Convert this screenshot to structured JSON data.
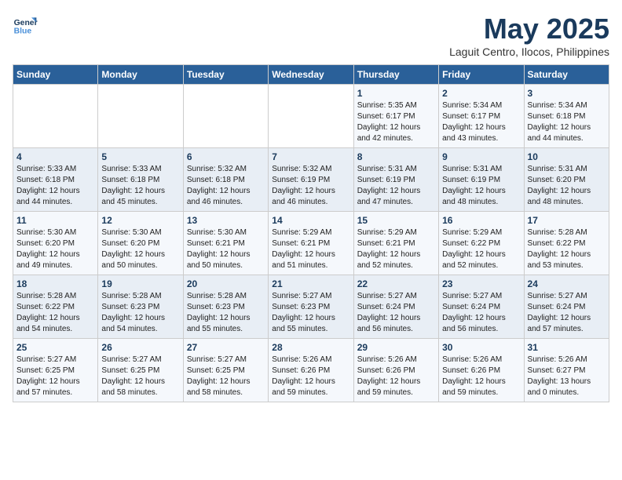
{
  "header": {
    "logo_line1": "General",
    "logo_line2": "Blue",
    "month": "May 2025",
    "location": "Laguit Centro, Ilocos, Philippines"
  },
  "weekdays": [
    "Sunday",
    "Monday",
    "Tuesday",
    "Wednesday",
    "Thursday",
    "Friday",
    "Saturday"
  ],
  "weeks": [
    [
      {
        "day": "",
        "info": ""
      },
      {
        "day": "",
        "info": ""
      },
      {
        "day": "",
        "info": ""
      },
      {
        "day": "",
        "info": ""
      },
      {
        "day": "1",
        "info": "Sunrise: 5:35 AM\nSunset: 6:17 PM\nDaylight: 12 hours\nand 42 minutes."
      },
      {
        "day": "2",
        "info": "Sunrise: 5:34 AM\nSunset: 6:17 PM\nDaylight: 12 hours\nand 43 minutes."
      },
      {
        "day": "3",
        "info": "Sunrise: 5:34 AM\nSunset: 6:18 PM\nDaylight: 12 hours\nand 44 minutes."
      }
    ],
    [
      {
        "day": "4",
        "info": "Sunrise: 5:33 AM\nSunset: 6:18 PM\nDaylight: 12 hours\nand 44 minutes."
      },
      {
        "day": "5",
        "info": "Sunrise: 5:33 AM\nSunset: 6:18 PM\nDaylight: 12 hours\nand 45 minutes."
      },
      {
        "day": "6",
        "info": "Sunrise: 5:32 AM\nSunset: 6:18 PM\nDaylight: 12 hours\nand 46 minutes."
      },
      {
        "day": "7",
        "info": "Sunrise: 5:32 AM\nSunset: 6:19 PM\nDaylight: 12 hours\nand 46 minutes."
      },
      {
        "day": "8",
        "info": "Sunrise: 5:31 AM\nSunset: 6:19 PM\nDaylight: 12 hours\nand 47 minutes."
      },
      {
        "day": "9",
        "info": "Sunrise: 5:31 AM\nSunset: 6:19 PM\nDaylight: 12 hours\nand 48 minutes."
      },
      {
        "day": "10",
        "info": "Sunrise: 5:31 AM\nSunset: 6:20 PM\nDaylight: 12 hours\nand 48 minutes."
      }
    ],
    [
      {
        "day": "11",
        "info": "Sunrise: 5:30 AM\nSunset: 6:20 PM\nDaylight: 12 hours\nand 49 minutes."
      },
      {
        "day": "12",
        "info": "Sunrise: 5:30 AM\nSunset: 6:20 PM\nDaylight: 12 hours\nand 50 minutes."
      },
      {
        "day": "13",
        "info": "Sunrise: 5:30 AM\nSunset: 6:21 PM\nDaylight: 12 hours\nand 50 minutes."
      },
      {
        "day": "14",
        "info": "Sunrise: 5:29 AM\nSunset: 6:21 PM\nDaylight: 12 hours\nand 51 minutes."
      },
      {
        "day": "15",
        "info": "Sunrise: 5:29 AM\nSunset: 6:21 PM\nDaylight: 12 hours\nand 52 minutes."
      },
      {
        "day": "16",
        "info": "Sunrise: 5:29 AM\nSunset: 6:22 PM\nDaylight: 12 hours\nand 52 minutes."
      },
      {
        "day": "17",
        "info": "Sunrise: 5:28 AM\nSunset: 6:22 PM\nDaylight: 12 hours\nand 53 minutes."
      }
    ],
    [
      {
        "day": "18",
        "info": "Sunrise: 5:28 AM\nSunset: 6:22 PM\nDaylight: 12 hours\nand 54 minutes."
      },
      {
        "day": "19",
        "info": "Sunrise: 5:28 AM\nSunset: 6:23 PM\nDaylight: 12 hours\nand 54 minutes."
      },
      {
        "day": "20",
        "info": "Sunrise: 5:28 AM\nSunset: 6:23 PM\nDaylight: 12 hours\nand 55 minutes."
      },
      {
        "day": "21",
        "info": "Sunrise: 5:27 AM\nSunset: 6:23 PM\nDaylight: 12 hours\nand 55 minutes."
      },
      {
        "day": "22",
        "info": "Sunrise: 5:27 AM\nSunset: 6:24 PM\nDaylight: 12 hours\nand 56 minutes."
      },
      {
        "day": "23",
        "info": "Sunrise: 5:27 AM\nSunset: 6:24 PM\nDaylight: 12 hours\nand 56 minutes."
      },
      {
        "day": "24",
        "info": "Sunrise: 5:27 AM\nSunset: 6:24 PM\nDaylight: 12 hours\nand 57 minutes."
      }
    ],
    [
      {
        "day": "25",
        "info": "Sunrise: 5:27 AM\nSunset: 6:25 PM\nDaylight: 12 hours\nand 57 minutes."
      },
      {
        "day": "26",
        "info": "Sunrise: 5:27 AM\nSunset: 6:25 PM\nDaylight: 12 hours\nand 58 minutes."
      },
      {
        "day": "27",
        "info": "Sunrise: 5:27 AM\nSunset: 6:25 PM\nDaylight: 12 hours\nand 58 minutes."
      },
      {
        "day": "28",
        "info": "Sunrise: 5:26 AM\nSunset: 6:26 PM\nDaylight: 12 hours\nand 59 minutes."
      },
      {
        "day": "29",
        "info": "Sunrise: 5:26 AM\nSunset: 6:26 PM\nDaylight: 12 hours\nand 59 minutes."
      },
      {
        "day": "30",
        "info": "Sunrise: 5:26 AM\nSunset: 6:26 PM\nDaylight: 12 hours\nand 59 minutes."
      },
      {
        "day": "31",
        "info": "Sunrise: 5:26 AM\nSunset: 6:27 PM\nDaylight: 13 hours\nand 0 minutes."
      }
    ]
  ]
}
